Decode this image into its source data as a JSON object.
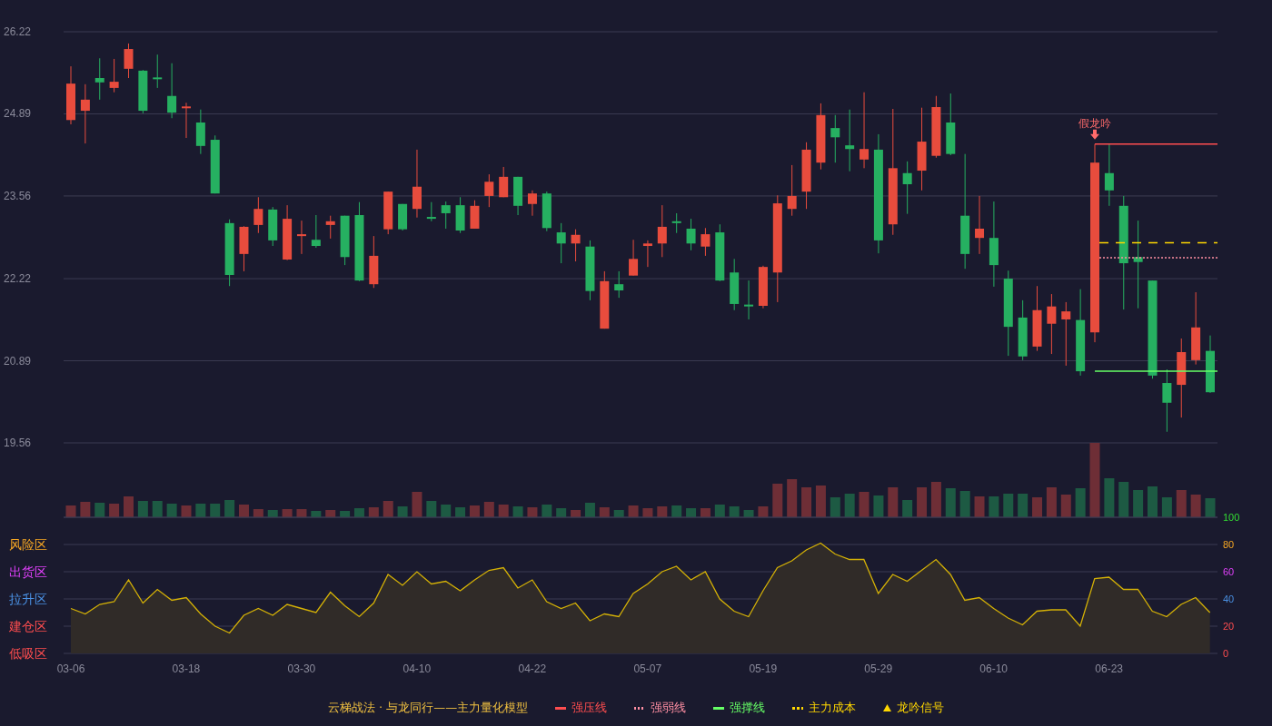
{
  "price_chart": {
    "chart_data": {
      "type": "candlestick",
      "grid": true,
      "ylim": [
        19.56,
        26.22
      ],
      "yticks": [
        {
          "value": 26.22,
          "label": "26.22"
        },
        {
          "value": 24.89,
          "label": "24.89"
        },
        {
          "value": 23.56,
          "label": "23.56"
        },
        {
          "value": 22.22,
          "label": "22.22"
        },
        {
          "value": 20.89,
          "label": "20.89"
        },
        {
          "value": 19.56,
          "label": "19.56"
        }
      ],
      "categories": [
        null,
        null,
        null,
        null,
        null,
        null,
        null,
        null,
        null,
        null,
        null,
        null,
        null,
        null,
        null,
        null,
        null,
        null,
        null,
        null,
        null,
        null,
        null,
        null,
        null,
        null,
        null,
        null,
        null,
        null,
        null,
        null,
        null,
        null,
        null,
        null,
        null,
        null,
        null,
        null,
        null,
        null,
        null,
        null,
        null,
        null,
        null,
        null,
        null,
        null,
        null,
        null,
        null,
        null,
        null,
        null,
        null,
        null,
        null,
        null,
        null,
        null,
        null,
        null,
        null,
        null,
        null,
        null,
        null,
        null,
        null,
        null,
        null,
        null,
        null,
        null,
        null,
        null,
        null,
        null
      ],
      "ohlc": [
        [
          24.79,
          25.66,
          24.72,
          25.38
        ],
        [
          24.94,
          25.37,
          24.41,
          25.12
        ],
        [
          25.47,
          25.79,
          25.12,
          25.4
        ],
        [
          25.31,
          25.78,
          25.24,
          25.41
        ],
        [
          25.62,
          26.03,
          25.47,
          25.94
        ],
        [
          25.59,
          25.6,
          24.9,
          24.94
        ],
        [
          25.48,
          25.85,
          25.31,
          25.46
        ],
        [
          25.18,
          25.71,
          24.82,
          24.91
        ],
        [
          24.99,
          25.07,
          24.5,
          25.01
        ],
        [
          24.75,
          24.96,
          24.24,
          24.37
        ],
        [
          24.47,
          24.54,
          23.6,
          23.6
        ],
        [
          23.12,
          23.18,
          22.1,
          22.28
        ],
        [
          22.62,
          23.07,
          22.34,
          23.06
        ],
        [
          23.09,
          23.54,
          22.96,
          23.35
        ],
        [
          23.34,
          23.38,
          22.75,
          22.84
        ],
        [
          22.53,
          23.41,
          22.52,
          23.19
        ],
        [
          22.91,
          23.16,
          22.62,
          22.94
        ],
        [
          22.85,
          23.25,
          22.72,
          22.75
        ],
        [
          23.09,
          23.24,
          22.87,
          23.15
        ],
        [
          23.24,
          23.24,
          22.44,
          22.57
        ],
        [
          23.25,
          23.46,
          22.18,
          22.19
        ],
        [
          22.13,
          22.91,
          22.07,
          22.59
        ],
        [
          23.02,
          23.63,
          22.94,
          23.63
        ],
        [
          23.43,
          23.43,
          23.0,
          23.02
        ],
        [
          23.35,
          24.31,
          23.21,
          23.71
        ],
        [
          23.22,
          23.46,
          23.15,
          23.19
        ],
        [
          23.41,
          23.47,
          23.03,
          23.28
        ],
        [
          23.41,
          23.54,
          22.96,
          23.0
        ],
        [
          23.03,
          23.49,
          23.03,
          23.4
        ],
        [
          23.56,
          23.91,
          23.38,
          23.79
        ],
        [
          23.54,
          24.03,
          23.54,
          23.87
        ],
        [
          23.87,
          23.87,
          23.25,
          23.4
        ],
        [
          23.43,
          23.65,
          23.24,
          23.6
        ],
        [
          23.6,
          23.63,
          22.99,
          23.04
        ],
        [
          22.97,
          23.12,
          22.47,
          22.79
        ],
        [
          22.79,
          23.02,
          22.5,
          22.93
        ],
        [
          22.74,
          22.84,
          21.87,
          22.02
        ],
        [
          21.41,
          22.34,
          21.41,
          22.18
        ],
        [
          22.13,
          22.34,
          21.91,
          22.03
        ],
        [
          22.27,
          22.85,
          22.27,
          22.54
        ],
        [
          22.75,
          22.84,
          22.41,
          22.79
        ],
        [
          22.79,
          23.41,
          22.57,
          23.06
        ],
        [
          23.15,
          23.28,
          22.96,
          23.12
        ],
        [
          23.03,
          23.19,
          22.68,
          22.79
        ],
        [
          22.74,
          23.04,
          22.59,
          22.94
        ],
        [
          22.97,
          23.1,
          22.18,
          22.19
        ],
        [
          22.32,
          22.54,
          21.71,
          21.81
        ],
        [
          21.8,
          22.19,
          21.56,
          21.77
        ],
        [
          21.78,
          22.43,
          21.74,
          22.41
        ],
        [
          22.32,
          23.57,
          21.84,
          23.44
        ],
        [
          23.35,
          24.06,
          23.24,
          23.56
        ],
        [
          23.63,
          24.43,
          23.35,
          24.31
        ],
        [
          24.1,
          25.06,
          23.99,
          24.87
        ],
        [
          24.66,
          24.87,
          24.1,
          24.51
        ],
        [
          24.38,
          24.96,
          23.96,
          24.32
        ],
        [
          24.15,
          25.24,
          24.01,
          24.32
        ],
        [
          24.31,
          24.56,
          22.63,
          22.84
        ],
        [
          23.1,
          24.97,
          22.93,
          24.01
        ],
        [
          23.93,
          24.12,
          23.27,
          23.75
        ],
        [
          23.97,
          24.99,
          23.65,
          24.44
        ],
        [
          24.21,
          25.18,
          24.18,
          25.0
        ],
        [
          24.75,
          25.22,
          24.22,
          24.24
        ],
        [
          23.24,
          24.24,
          22.38,
          22.62
        ],
        [
          22.88,
          23.56,
          22.62,
          23.03
        ],
        [
          22.88,
          23.47,
          22.09,
          22.44
        ],
        [
          22.22,
          22.35,
          20.97,
          21.44
        ],
        [
          21.59,
          21.87,
          20.9,
          20.96
        ],
        [
          21.12,
          22.1,
          21.05,
          21.71
        ],
        [
          21.49,
          21.97,
          21.0,
          21.77
        ],
        [
          21.56,
          21.84,
          20.81,
          21.69
        ],
        [
          21.55,
          22.05,
          20.65,
          20.72
        ],
        [
          21.35,
          24.4,
          21.19,
          24.1
        ],
        [
          23.93,
          24.41,
          23.4,
          23.65
        ],
        [
          23.4,
          23.56,
          21.72,
          22.47
        ],
        [
          22.57,
          23.16,
          21.74,
          22.49
        ],
        [
          22.19,
          22.19,
          20.6,
          20.65
        ],
        [
          20.53,
          20.75,
          19.74,
          20.21
        ],
        [
          20.5,
          21.25,
          19.97,
          21.03
        ],
        [
          20.9,
          22.0,
          20.83,
          21.43
        ],
        [
          21.05,
          21.3,
          20.37,
          20.38
        ]
      ],
      "annotations": [
        {
          "text": "假龙吟"
        }
      ],
      "ref_lines": [
        {
          "value": 24.4,
          "axis": "y",
          "color": "#ff4d4f"
        },
        {
          "value": 22.8,
          "axis": "y",
          "color": "#ffd700"
        },
        {
          "value": 22.56,
          "axis": "y",
          "color": "#ff8fa3"
        },
        {
          "value": 20.72,
          "axis": "y",
          "color": "#66ff66"
        }
      ]
    }
  },
  "indicator_chart": {
    "zones": [
      {
        "label": "风险区",
        "color": "#f5a623"
      },
      {
        "label": "出货区",
        "color": "#e040fb"
      },
      {
        "label": "拉升区",
        "color": "#4a90e2"
      },
      {
        "label": "建仓区",
        "color": "#ff4d4f"
      },
      {
        "label": "低吸区",
        "color": "#ff4d4f"
      }
    ],
    "chart_data": {
      "type": "area",
      "grid": true,
      "ylim": [
        0,
        100
      ],
      "yticks": [
        100,
        80,
        60,
        40,
        20,
        0
      ],
      "categories": [
        "03-06",
        null,
        null,
        null,
        null,
        null,
        null,
        null,
        "03-18",
        null,
        null,
        null,
        null,
        null,
        null,
        null,
        "03-30",
        null,
        null,
        null,
        null,
        null,
        null,
        null,
        "04-10",
        null,
        null,
        null,
        null,
        null,
        null,
        null,
        "04-22",
        null,
        null,
        null,
        null,
        null,
        null,
        null,
        "05-07",
        null,
        null,
        null,
        null,
        null,
        null,
        null,
        "05-19",
        null,
        null,
        null,
        null,
        null,
        null,
        null,
        "05-29",
        null,
        null,
        null,
        null,
        null,
        null,
        null,
        "06-10",
        null,
        null,
        null,
        null,
        null,
        null,
        null,
        "06-23",
        null,
        null,
        null,
        null,
        null,
        null,
        null
      ],
      "values": [
        33,
        29,
        36,
        38,
        54,
        37,
        47,
        39,
        41,
        29,
        20,
        15,
        28,
        33,
        28,
        36,
        33,
        30,
        45,
        35,
        27,
        37,
        58,
        50,
        60,
        51,
        53,
        46,
        54,
        61,
        63,
        48,
        54,
        38,
        33,
        37,
        24,
        29,
        27,
        44,
        51,
        60,
        64,
        54,
        60,
        40,
        31,
        27,
        46,
        63,
        68,
        76,
        81,
        73,
        69,
        69,
        44,
        58,
        53,
        61,
        69,
        58,
        39,
        41,
        33,
        26,
        21,
        31,
        32,
        32,
        20,
        55,
        56,
        47,
        47,
        31,
        27,
        36,
        41,
        30
      ]
    }
  },
  "legend": {
    "title": "云梯战法 · 与龙同行——主力量化模型",
    "items": [
      {
        "kind": "solid",
        "label": "强压线",
        "color": "#ff4d4f"
      },
      {
        "kind": "dotted",
        "label": "强弱线",
        "color": "#ff8fa3"
      },
      {
        "kind": "solid",
        "label": "强撑线",
        "color": "#66ff66"
      },
      {
        "kind": "dashed",
        "label": "主力成本",
        "color": "#ffd700"
      },
      {
        "kind": "triangle",
        "label": "龙吟信号",
        "color": "#ffd700"
      }
    ]
  }
}
